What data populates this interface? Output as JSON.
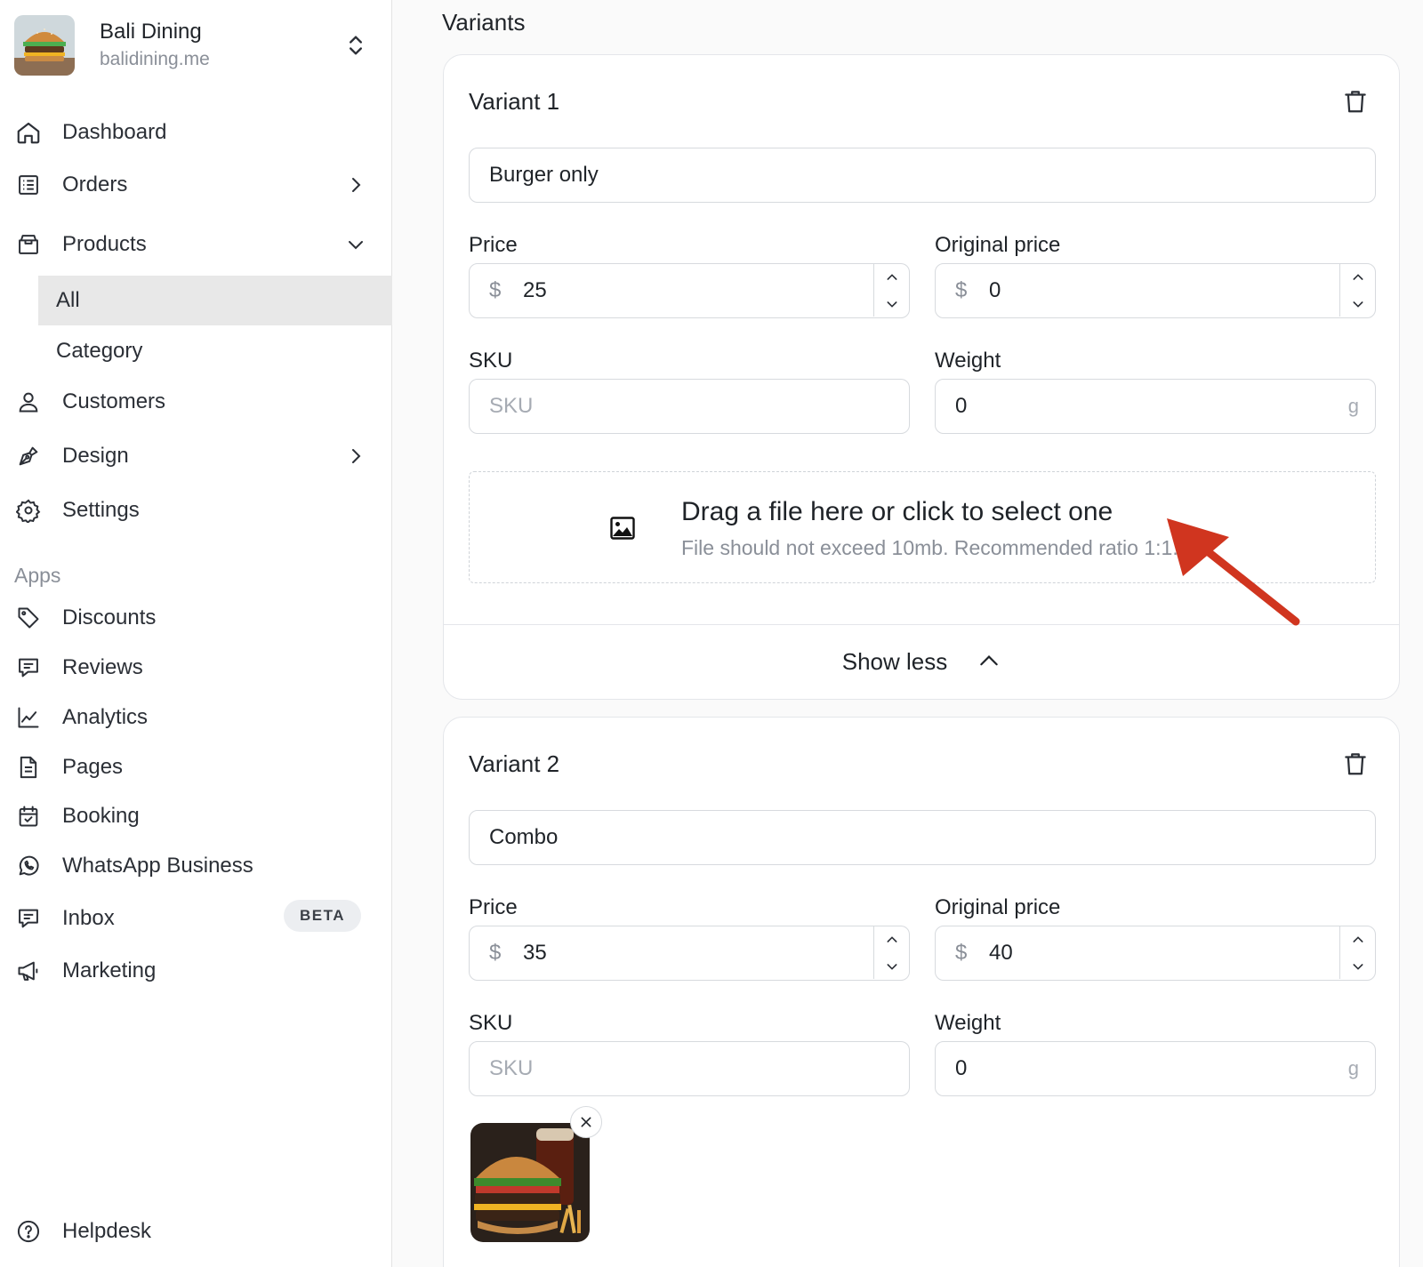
{
  "brand": {
    "name": "Bali Dining",
    "domain": "balidining.me"
  },
  "nav": {
    "dashboard": "Dashboard",
    "orders": "Orders",
    "products": "Products",
    "products_all": "All",
    "products_category": "Category",
    "customers": "Customers",
    "design": "Design",
    "settings": "Settings",
    "apps_title": "Apps",
    "discounts": "Discounts",
    "reviews": "Reviews",
    "analytics": "Analytics",
    "pages": "Pages",
    "booking": "Booking",
    "whatsapp": "WhatsApp Business",
    "inbox": "Inbox",
    "inbox_badge": "BETA",
    "marketing": "Marketing",
    "helpdesk": "Helpdesk"
  },
  "main": {
    "title": "Variants",
    "variant1": {
      "title": "Variant 1",
      "name": "Burger only",
      "price_label": "Price",
      "price_currency": "$",
      "price": "25",
      "original_label": "Original price",
      "original_currency": "$",
      "original": "0",
      "sku_label": "SKU",
      "sku_placeholder": "SKU",
      "weight_label": "Weight",
      "weight": "0",
      "weight_unit": "g",
      "dropzone_title": "Drag a file here or click to select one",
      "dropzone_sub": "File should not exceed 10mb. Recommended ratio 1:1.",
      "show_less": "Show less"
    },
    "variant2": {
      "title": "Variant 2",
      "name": "Combo",
      "price_label": "Price",
      "price_currency": "$",
      "price": "35",
      "original_label": "Original price",
      "original_currency": "$",
      "original": "40",
      "sku_label": "SKU",
      "sku_placeholder": "SKU",
      "weight_label": "Weight",
      "weight": "0",
      "weight_unit": "g"
    }
  },
  "colors": {
    "annotation_arrow": "#d0351f",
    "active_nav_bg": "#e8e8e8"
  },
  "icons": [
    "home-icon",
    "orders-icon",
    "products-icon",
    "customers-icon",
    "design-icon",
    "settings-icon",
    "discounts-icon",
    "reviews-icon",
    "analytics-icon",
    "pages-icon",
    "booking-icon",
    "whatsapp-icon",
    "inbox-icon",
    "marketing-icon",
    "helpdesk-icon",
    "trash-icon",
    "image-icon"
  ]
}
